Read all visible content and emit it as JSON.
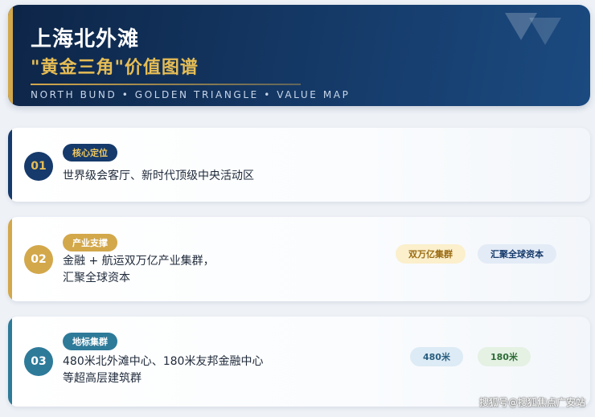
{
  "header": {
    "title": "上海北外滩",
    "subtitle": "\"黄金三角\"价值图谱",
    "en_line": "NORTH BUND  •  GOLDEN TRIANGLE  •  VALUE MAP"
  },
  "cards": [
    {
      "number": "01",
      "tag": "核心定位",
      "desc_lines": [
        "世界级会客厅、新时代顶级中央活动区"
      ],
      "pills": []
    },
    {
      "number": "02",
      "tag": "产业支撑",
      "desc_lines": [
        "金融 + 航运双万亿产业集群，",
        "汇聚全球资本"
      ],
      "pills": [
        "双万亿集群",
        "汇聚全球资本"
      ]
    },
    {
      "number": "03",
      "tag": "地标集群",
      "desc_lines": [
        "480米北外滩中心、180米友邦金融中心",
        "等超高层建筑群"
      ],
      "pills": [
        "480米",
        "180米"
      ]
    }
  ],
  "watermark": "搜狐号@搜狐焦点广安站",
  "colors": {
    "navy": "#163a6b",
    "gold": "#d3a84b",
    "teal": "#2e7a99",
    "background": "#eef2f7"
  }
}
